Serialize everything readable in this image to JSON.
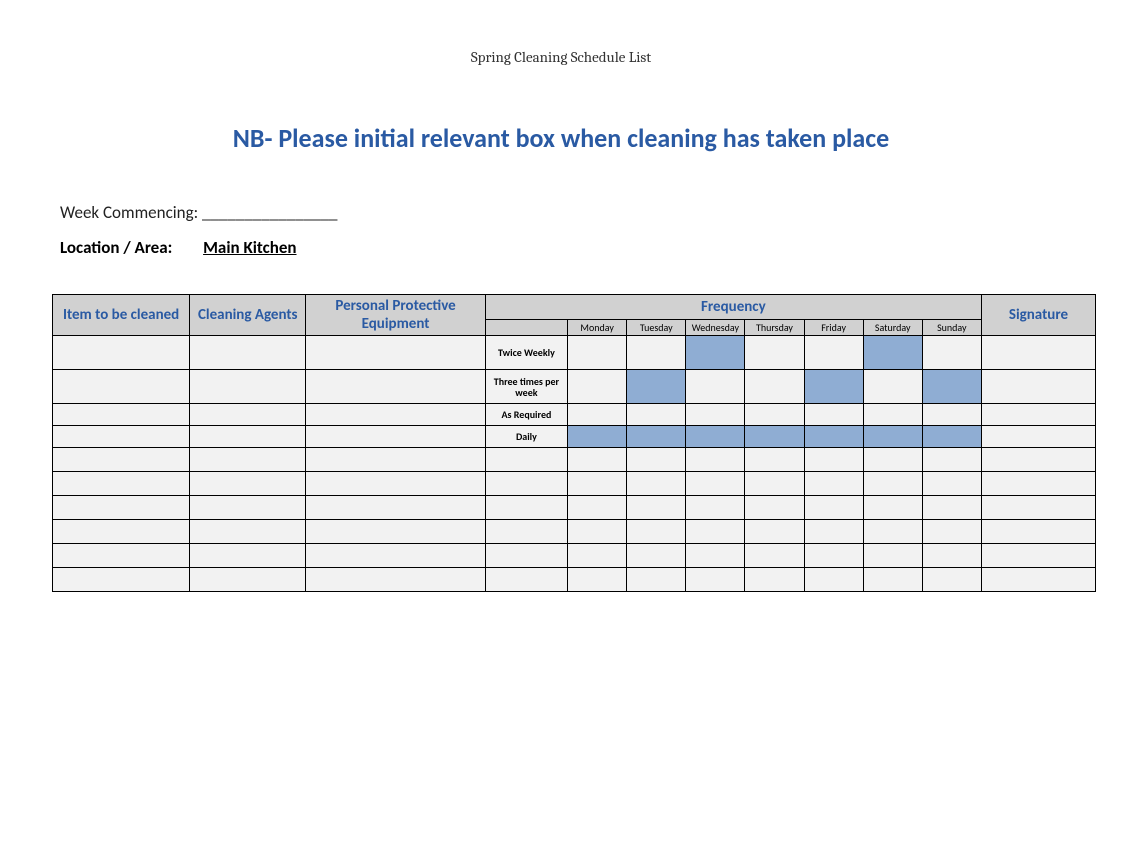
{
  "title": "Spring Cleaning Schedule List",
  "nb": "NB- Please initial relevant box when cleaning has taken place",
  "week_label": "Week Commencing: ________________",
  "location_label": "Location / Area:",
  "location_value": "Main Kitchen",
  "headers": {
    "item": "Item to be cleaned",
    "agents": "Cleaning Agents",
    "ppe": "Personal Protective Equipment",
    "frequency": "Frequency",
    "signature": "Signature"
  },
  "days": [
    "Monday",
    "Tuesday",
    "Wednesday",
    "Thursday",
    "Friday",
    "Saturday",
    "Sunday"
  ],
  "rows": [
    {
      "item": "",
      "agents": "",
      "ppe": "",
      "freq_label": "Twice Weekly",
      "shaded": [
        false,
        false,
        true,
        false,
        false,
        true,
        false
      ],
      "sig": ""
    },
    {
      "item": "",
      "agents": "",
      "ppe": "",
      "freq_label": "Three times per week",
      "shaded": [
        false,
        true,
        false,
        false,
        true,
        false,
        true
      ],
      "sig": ""
    },
    {
      "item": "",
      "agents": "",
      "ppe": "",
      "freq_label": "As Required",
      "shaded": [
        false,
        false,
        false,
        false,
        false,
        false,
        false
      ],
      "sig": ""
    },
    {
      "item": "",
      "agents": "",
      "ppe": "",
      "freq_label": "Daily",
      "shaded": [
        true,
        true,
        true,
        true,
        true,
        true,
        true
      ],
      "sig": ""
    },
    {
      "item": "",
      "agents": "",
      "ppe": "",
      "freq_label": "",
      "shaded": [
        false,
        false,
        false,
        false,
        false,
        false,
        false
      ],
      "sig": ""
    },
    {
      "item": "",
      "agents": "",
      "ppe": "",
      "freq_label": "",
      "shaded": [
        false,
        false,
        false,
        false,
        false,
        false,
        false
      ],
      "sig": ""
    },
    {
      "item": "",
      "agents": "",
      "ppe": "",
      "freq_label": "",
      "shaded": [
        false,
        false,
        false,
        false,
        false,
        false,
        false
      ],
      "sig": ""
    },
    {
      "item": "",
      "agents": "",
      "ppe": "",
      "freq_label": "",
      "shaded": [
        false,
        false,
        false,
        false,
        false,
        false,
        false
      ],
      "sig": ""
    },
    {
      "item": "",
      "agents": "",
      "ppe": "",
      "freq_label": "",
      "shaded": [
        false,
        false,
        false,
        false,
        false,
        false,
        false
      ],
      "sig": ""
    },
    {
      "item": "",
      "agents": "",
      "ppe": "",
      "freq_label": "",
      "shaded": [
        false,
        false,
        false,
        false,
        false,
        false,
        false
      ],
      "sig": ""
    }
  ]
}
